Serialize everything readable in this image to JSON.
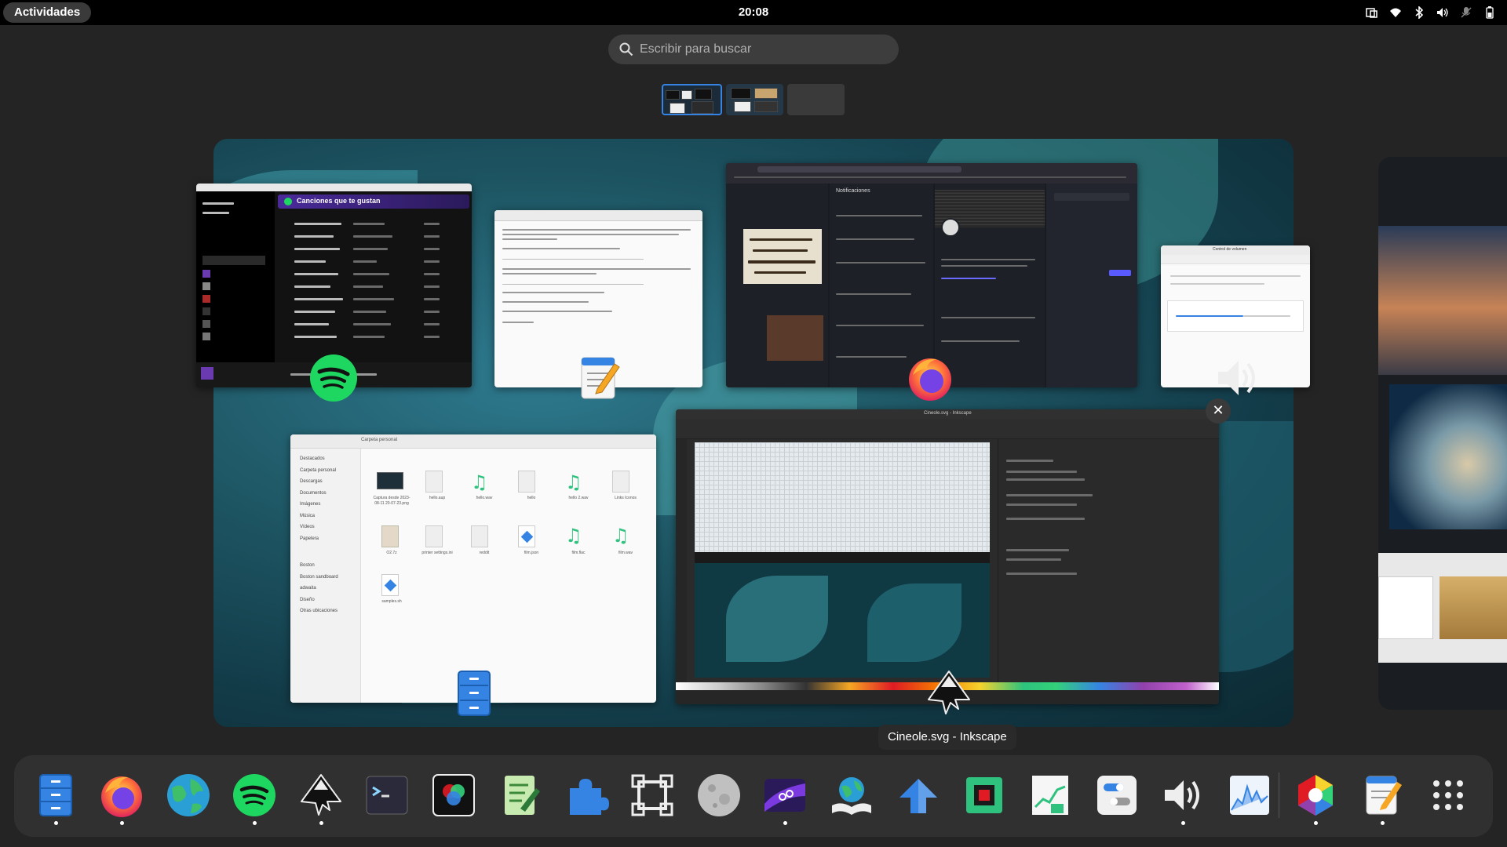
{
  "topbar": {
    "activities": "Actividades",
    "clock": "20:08"
  },
  "tray_icons": [
    "screen-record-icon",
    "wifi-icon",
    "bluetooth-icon",
    "volume-icon",
    "microphone-off-icon",
    "battery-icon"
  ],
  "search": {
    "placeholder": "Escribir para buscar"
  },
  "workspaces": [
    "workspace-1",
    "workspace-2",
    "workspace-3"
  ],
  "windows": {
    "spotify": {
      "heading": "Canciones que te gustan",
      "app": "Spotify"
    },
    "editor": {
      "app": "Editor de texto"
    },
    "firefox": {
      "heading": "Notificaciones",
      "app": "Firefox"
    },
    "volume": {
      "title": "Control de volumen",
      "app": "Control de volumen"
    },
    "files": {
      "breadcrumb": "Carpeta personal",
      "sidebar": [
        "Destacados",
        "Carpeta personal",
        "Descargas",
        "Documentos",
        "Imágenes",
        "Música",
        "Vídeos",
        "Papelera",
        "Boston",
        "Boston sandboard",
        "adwaita",
        "Diseño",
        "Otras ubicaciones"
      ],
      "items": [
        "Captura desde 2023-08-11 20-07-23.png",
        "hello.aup",
        "hello.wav",
        "hello",
        "hello 2.wav",
        "Links Iconos",
        "O2.7z",
        "printer settings.ini",
        "reddit",
        "film.json",
        "film.flac",
        "film.wav",
        "samples.sh"
      ]
    },
    "inkscape": {
      "title": "Cineole.svg - Inkscape"
    }
  },
  "tooltip": "Cineole.svg - Inkscape",
  "dock": [
    {
      "name": "files-icon",
      "running": true
    },
    {
      "name": "firefox-icon",
      "running": true
    },
    {
      "name": "web-browser-icon",
      "running": false
    },
    {
      "name": "spotify-icon",
      "running": true
    },
    {
      "name": "inkscape-icon",
      "running": true
    },
    {
      "name": "terminal-icon",
      "running": false
    },
    {
      "name": "color-picker-icon",
      "running": false
    },
    {
      "name": "notes-icon",
      "running": false
    },
    {
      "name": "extensions-icon",
      "running": false
    },
    {
      "name": "vector-tool-icon",
      "running": false
    },
    {
      "name": "moon-icon",
      "running": false
    },
    {
      "name": "video-editor-icon",
      "running": true
    },
    {
      "name": "dictionary-icon",
      "running": false
    },
    {
      "name": "upload-icon",
      "running": false
    },
    {
      "name": "chip-icon",
      "running": false
    },
    {
      "name": "stocks-icon",
      "running": false
    },
    {
      "name": "tweaks-icon",
      "running": false
    },
    {
      "name": "volume-control-icon",
      "running": true
    },
    {
      "name": "system-monitor-icon",
      "running": false
    },
    {
      "name": "color-wheel-icon",
      "running": true
    },
    {
      "name": "text-editor-icon",
      "running": true
    },
    {
      "name": "app-grid-icon",
      "running": false
    }
  ]
}
